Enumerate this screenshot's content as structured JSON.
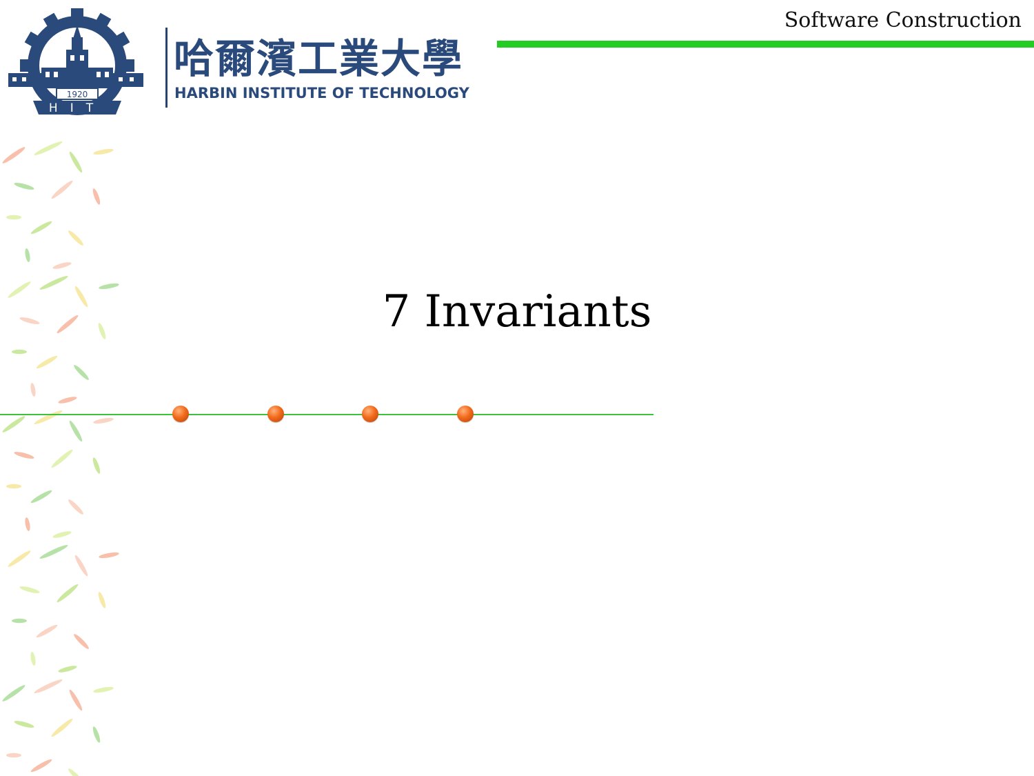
{
  "header": {
    "course_title": "Software Construction",
    "accent_color": "#22cc22"
  },
  "logo": {
    "seal_year": "1920",
    "seal_letters": "HIT",
    "university_name_cn": "哈爾濱工業大學",
    "university_name_en": "HARBIN INSTITUTE OF TECHNOLOGY",
    "brand_color": "#2b4a7c"
  },
  "slide": {
    "title": "7 Invariants"
  },
  "decoration": {
    "bullet_color": "#f26a1b",
    "line_color": "#3cc13c"
  }
}
